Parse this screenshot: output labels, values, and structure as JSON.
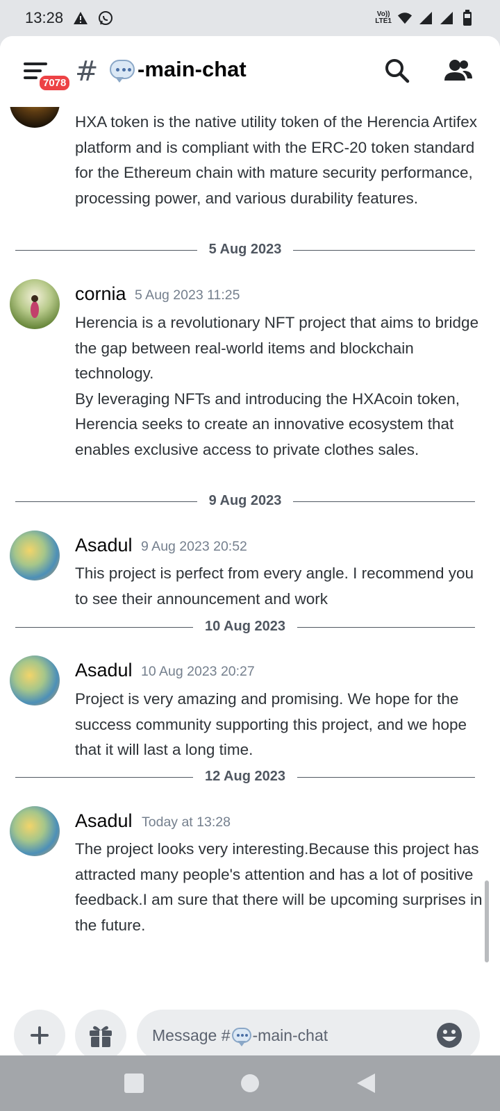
{
  "status_bar": {
    "time": "13:28",
    "carrier_tag_line1": "Vo))",
    "carrier_tag_line2": "LTE1"
  },
  "header": {
    "unread_count": "7078",
    "channel_name": "-main-chat"
  },
  "messages": [
    {
      "id": "m0",
      "text": "HXA token is the native utility token of the Herencia Artifex platform and is compliant with the ERC-20 token standard for the Ethereum chain with mature security performance, processing power, and various durability features."
    },
    {
      "id": "m1",
      "username": "cornia",
      "timestamp": "5 Aug 2023 11:25",
      "text": "Herencia is a revolutionary NFT project that aims to bridge the gap between real-world items and blockchain technology.\nBy leveraging NFTs and introducing the HXAcoin token, Herencia seeks to create an innovative ecosystem that enables exclusive access to private clothes sales."
    },
    {
      "id": "m2",
      "username": "Asadul",
      "timestamp": "9 Aug 2023 20:52",
      "text": "This project is perfect from every angle. I recommend you to see their announcement and work"
    },
    {
      "id": "m3",
      "username": "Asadul",
      "timestamp": "10 Aug 2023 20:27",
      "text": "Project is very amazing and promising. We hope for the success community supporting this project, and we hope that it will last a long time."
    },
    {
      "id": "m4",
      "username": "Asadul",
      "timestamp": "Today at 13:28",
      "text": "The project looks very interesting.Because this project has attracted many people's attention and has a lot of positive feedback.I am sure that there will be upcoming surprises in the future."
    }
  ],
  "dividers": [
    "5 Aug 2023",
    "9 Aug 2023",
    "10 Aug 2023",
    "12 Aug 2023"
  ],
  "composer": {
    "placeholder_prefix": "Message #",
    "placeholder_channel": "-main-chat"
  },
  "icons": {
    "menu": "hamburger-menu-icon",
    "search": "search-icon",
    "members": "members-icon",
    "add": "plus-icon",
    "gift": "gift-icon",
    "emoji": "smiley-icon"
  },
  "colors": {
    "badge": "#ed4245",
    "background": "#ffffff",
    "status_bar": "#e3e5e8",
    "nav_bar": "#a3a6aa"
  }
}
